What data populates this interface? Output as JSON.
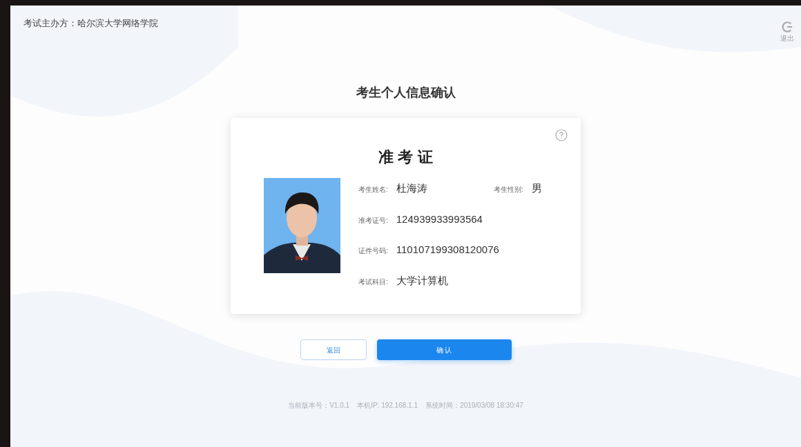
{
  "header": {
    "organizer": "考试主办方：哈尔滨大学网络学院",
    "logout": "退出"
  },
  "title": "考生个人信息确认",
  "card": {
    "title": "准 考 证",
    "fields": [
      {
        "label": "考生姓名:",
        "value": "杜海涛"
      },
      {
        "label": "考生性别:",
        "value": "男"
      },
      {
        "label": "准考证号:",
        "value": "124939933993564"
      },
      {
        "label": "证件号码:",
        "value": "110107199308120076"
      },
      {
        "label": "考试科目:",
        "value": "大学计算机"
      }
    ]
  },
  "buttons": {
    "back": "返回",
    "confirm": "确 认"
  },
  "footer": "当前版本号：V1.0.1    本机IP: 192.168.1.1    系统时间：2019/03/08 18:30:47"
}
